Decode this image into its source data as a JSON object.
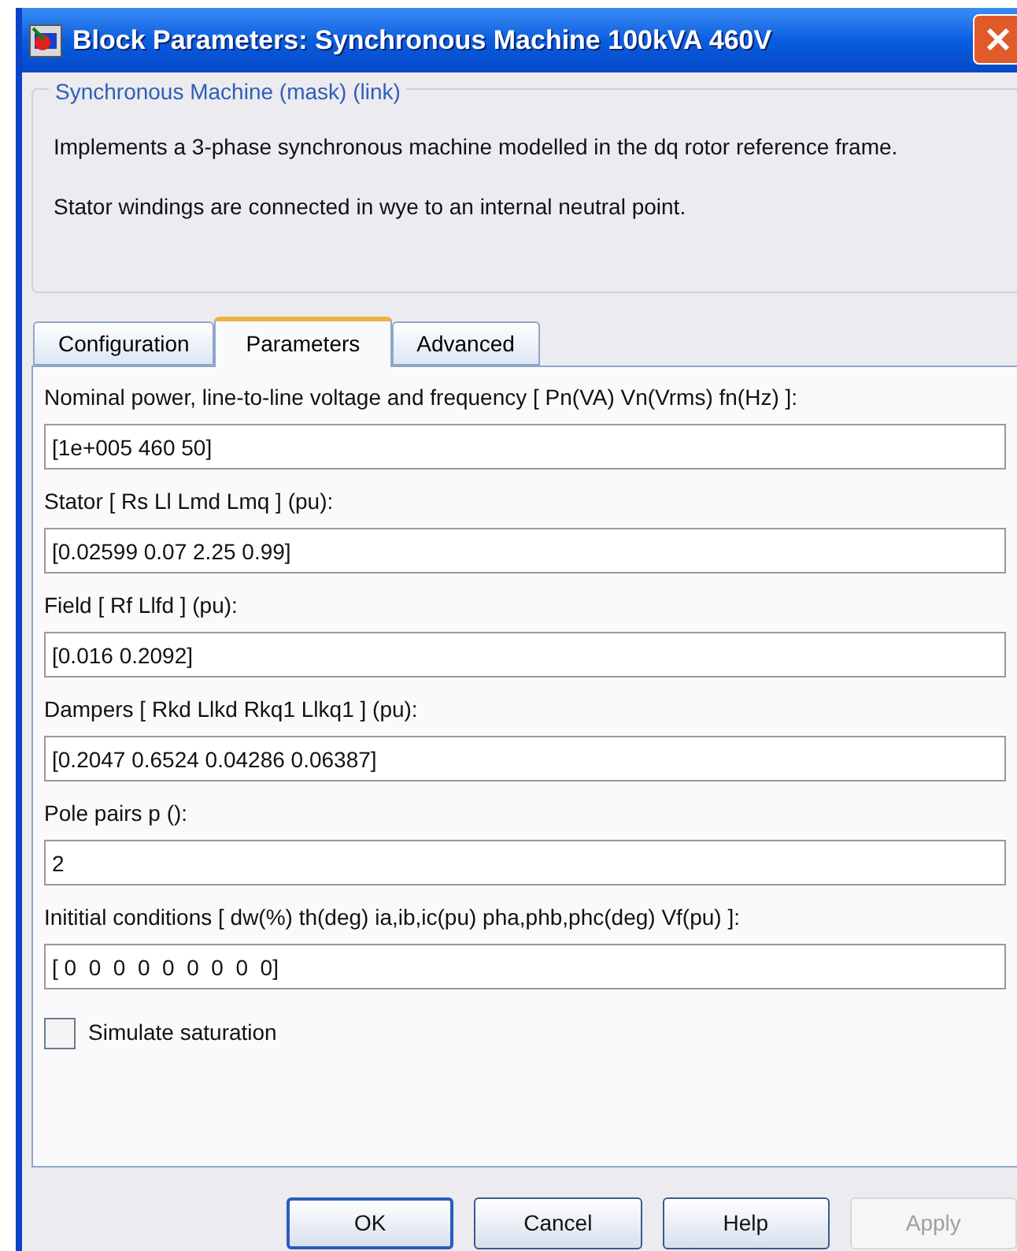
{
  "window": {
    "title": "Block Parameters: Synchronous Machine 100kVA 460V"
  },
  "description": {
    "title": "Synchronous Machine (mask) (link)",
    "paragraphs": [
      "Implements a 3-phase synchronous machine modelled in the dq rotor reference frame.",
      "Stator windings are connected in wye to an internal neutral point."
    ]
  },
  "tabs": [
    {
      "label": "Configuration",
      "selected": false
    },
    {
      "label": "Parameters",
      "selected": true
    },
    {
      "label": "Advanced",
      "selected": false
    }
  ],
  "fields": [
    {
      "label": "Nominal power, line-to-line voltage and frequency [ Pn(VA)  Vn(Vrms)  fn(Hz) ]:",
      "value": "[1e+005 460 50]"
    },
    {
      "label": "Stator  [ Rs  Ll  Lmd  Lmq ] (pu):",
      "value": "[0.02599 0.07 2.25 0.99]"
    },
    {
      "label": "Field  [ Rf  Llfd ] (pu):",
      "value": "[0.016 0.2092]"
    },
    {
      "label": "Dampers  [ Rkd  Llkd  Rkq1  Llkq1 ] (pu):",
      "value": "[0.2047 0.6524 0.04286 0.06387]"
    },
    {
      "label": "Pole pairs p ():",
      "value": "2"
    },
    {
      "label": "Inititial conditions [ dw(%)  th(deg)  ia,ib,ic(pu)  pha,phb,phc(deg)  Vf(pu) ]:",
      "value": "[ 0  0  0  0  0  0  0  0  0]"
    }
  ],
  "checkbox": {
    "label": "Simulate saturation",
    "checked": false
  },
  "buttons": [
    {
      "label": "OK",
      "default": true,
      "disabled": false
    },
    {
      "label": "Cancel",
      "default": false,
      "disabled": false
    },
    {
      "label": "Help",
      "default": false,
      "disabled": false
    },
    {
      "label": "Apply",
      "default": false,
      "disabled": true
    }
  ]
}
